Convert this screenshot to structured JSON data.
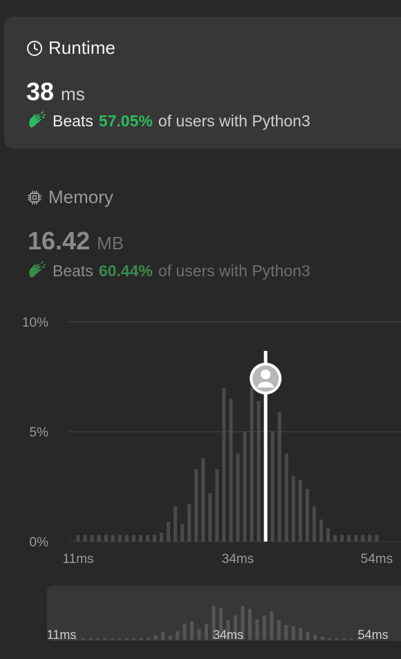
{
  "colors": {
    "background": "#282828",
    "card": "#373737",
    "accent_green": "#2cbb5d",
    "muted_green": "#3a8a4c",
    "bar": "#4a4a4a",
    "marker": "#ffffff"
  },
  "runtime": {
    "title": "Runtime",
    "icon": "clock-icon",
    "value": "38",
    "unit": "ms",
    "beats_prefix": "Beats",
    "beats_pct": "57.05%",
    "beats_suffix": "of users with Python3"
  },
  "memory": {
    "title": "Memory",
    "icon": "chip-icon",
    "value": "16.42",
    "unit": "MB",
    "beats_prefix": "Beats",
    "beats_pct": "60.44%",
    "beats_suffix": "of users with Python3"
  },
  "chart_data": {
    "type": "bar",
    "y_tick_labels": [
      "10%",
      "5%",
      "0%"
    ],
    "y_ticks": [
      10,
      5,
      0
    ],
    "ylim": [
      0,
      10
    ],
    "x_tick_labels": [
      "11ms",
      "34ms",
      "54ms"
    ],
    "x_ticks": [
      11,
      34,
      54
    ],
    "x": [
      11,
      12,
      13,
      14,
      15,
      16,
      17,
      18,
      19,
      20,
      21,
      22,
      23,
      24,
      25,
      26,
      27,
      28,
      29,
      30,
      31,
      32,
      33,
      34,
      35,
      36,
      37,
      38,
      39,
      40,
      41,
      42,
      43,
      44,
      45,
      46,
      47,
      48,
      49,
      50,
      51,
      52,
      53,
      54
    ],
    "values": [
      0.3,
      0.3,
      0.3,
      0.3,
      0.3,
      0.3,
      0.3,
      0.3,
      0.3,
      0.3,
      0.3,
      0.3,
      0.4,
      0.9,
      1.6,
      0.8,
      1.7,
      3.3,
      3.8,
      2.2,
      3.3,
      7.0,
      6.5,
      4.0,
      5.0,
      7.0,
      6.4,
      4.2,
      5.0,
      5.9,
      4.0,
      3.0,
      2.8,
      2.4,
      1.6,
      1.0,
      0.6,
      0.3,
      0.3,
      0.3,
      0.3,
      0.3,
      0.3,
      0.3
    ],
    "marker_x": 38,
    "grid": true
  },
  "minimap": {
    "x_tick_labels": [
      "11ms",
      "34ms",
      "54ms"
    ]
  }
}
